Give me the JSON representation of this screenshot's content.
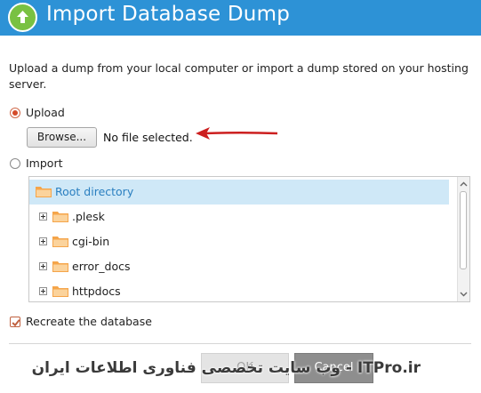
{
  "header": {
    "title": "Import Database Dump",
    "icon": "upload-arrow-icon",
    "bg_color": "#2d92d6",
    "icon_color": "#79c142"
  },
  "description": "Upload a dump from your local computer or import a dump stored on your hosting server.",
  "upload_option": {
    "label": "Upload",
    "selected": true
  },
  "file_input": {
    "button_label": "Browse...",
    "status": "No file selected."
  },
  "annotation": {
    "type": "arrow",
    "color": "#cc1f1f"
  },
  "import_option": {
    "label": "Import",
    "selected": false
  },
  "tree": {
    "root": {
      "label": "Root directory",
      "selected": true
    },
    "children": [
      {
        "label": ".plesk"
      },
      {
        "label": "cgi-bin"
      },
      {
        "label": "error_docs"
      },
      {
        "label": "httpdocs"
      }
    ]
  },
  "recreate": {
    "label": "Recreate the database",
    "checked": true
  },
  "buttons": {
    "ok_label": "OK",
    "cancel_label": "Cancel"
  },
  "watermark": {
    "text": "ITPro.ir - وب سایت تخصصی فناوری اطلاعات ایران"
  },
  "colors": {
    "accent": "#d44b2a",
    "selected_row": "#cfe8f7",
    "folder": "#f5a54a"
  }
}
